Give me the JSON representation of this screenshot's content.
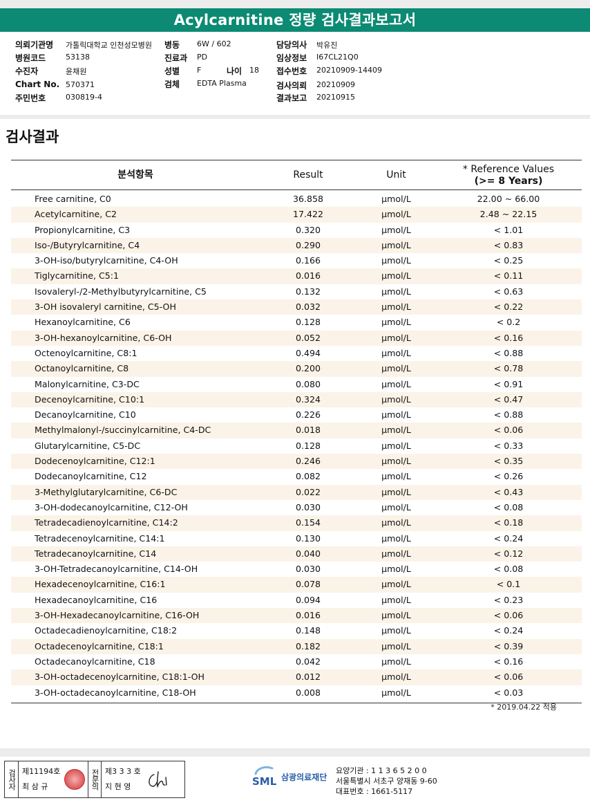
{
  "title": "Acylcarnitine 정량 검사결과보고서",
  "info": {
    "col1": [
      {
        "label": "의뢰기관명",
        "value": "가톨릭대학교 인천성모병원"
      },
      {
        "label": "병원코드",
        "value": "53138"
      },
      {
        "label": "수진자",
        "value": "윤채원"
      },
      {
        "label": "Chart No.",
        "value": "570371"
      },
      {
        "label": "주민번호",
        "value": "030819-4"
      }
    ],
    "col2": [
      {
        "label": "병동",
        "value": "6W / 602"
      },
      {
        "label": "진료과",
        "value": "PD"
      },
      {
        "label": "성별",
        "value": "F"
      },
      {
        "label": "검체",
        "value": "EDTA Plasma"
      }
    ],
    "age": {
      "label": "나이",
      "value": "18"
    },
    "col3": [
      {
        "label": "담당의사",
        "value": "박유진"
      },
      {
        "label": "임상정보",
        "value": "I67CL21Q0"
      },
      {
        "label": "접수번호",
        "value": "20210909-14409"
      },
      {
        "label": "검사의뢰",
        "value": "20210909"
      },
      {
        "label": "결과보고",
        "value": "20210915"
      }
    ]
  },
  "section_title": "검사결과",
  "table": {
    "headers": {
      "item": "분석항목",
      "result": "Result",
      "unit": "Unit",
      "ref_line1": "* Reference Values",
      "ref_line2": "(>= 8 Years)"
    },
    "rows": [
      {
        "name": "Free carnitine, C0",
        "result": "36.858",
        "unit": "µmol/L",
        "ref": "22.00 ~ 66.00"
      },
      {
        "name": "Acetylcarnitine, C2",
        "result": "17.422",
        "unit": "µmol/L",
        "ref": "2.48 ~ 22.15"
      },
      {
        "name": "Propionylcarnitine, C3",
        "result": "0.320",
        "unit": "µmol/L",
        "ref": "< 1.01"
      },
      {
        "name": "Iso-/Butyrylcarnitine, C4",
        "result": "0.290",
        "unit": "µmol/L",
        "ref": "< 0.83"
      },
      {
        "name": "3-OH-iso/butyrylcarnitine, C4-OH",
        "result": "0.166",
        "unit": "µmol/L",
        "ref": "< 0.25"
      },
      {
        "name": "Tiglycarnitine, C5:1",
        "result": "0.016",
        "unit": "µmol/L",
        "ref": "< 0.11"
      },
      {
        "name": "Isovaleryl-/2-Methylbutyrylcarnitine, C5",
        "result": "0.132",
        "unit": "µmol/L",
        "ref": "< 0.63"
      },
      {
        "name": "3-OH isovaleryl carnitine, C5-OH",
        "result": "0.032",
        "unit": "µmol/L",
        "ref": "< 0.22"
      },
      {
        "name": "Hexanoylcarnitine, C6",
        "result": "0.128",
        "unit": "µmol/L",
        "ref": "< 0.2"
      },
      {
        "name": "3-OH-hexanoylcarnitine, C6-OH",
        "result": "0.052",
        "unit": "µmol/L",
        "ref": "< 0.16"
      },
      {
        "name": "Octenoylcarnitine, C8:1",
        "result": "0.494",
        "unit": "µmol/L",
        "ref": "< 0.88"
      },
      {
        "name": "Octanoylcarnitine, C8",
        "result": "0.200",
        "unit": "µmol/L",
        "ref": "< 0.78"
      },
      {
        "name": "Malonylcarnitine, C3-DC",
        "result": "0.080",
        "unit": "µmol/L",
        "ref": "< 0.91"
      },
      {
        "name": "Decenoylcarnitine, C10:1",
        "result": "0.324",
        "unit": "µmol/L",
        "ref": "< 0.47"
      },
      {
        "name": "Decanoylcarnitine, C10",
        "result": "0.226",
        "unit": "µmol/L",
        "ref": "< 0.88"
      },
      {
        "name": "Methylmalonyl-/succinylcarnitine, C4-DC",
        "result": "0.018",
        "unit": "µmol/L",
        "ref": "< 0.06"
      },
      {
        "name": "Glutarylcarnitine, C5-DC",
        "result": "0.128",
        "unit": "µmol/L",
        "ref": "< 0.33"
      },
      {
        "name": "Dodecenoylcarnitine, C12:1",
        "result": "0.246",
        "unit": "µmol/L",
        "ref": "< 0.35"
      },
      {
        "name": "Dodecanoylcarnitine, C12",
        "result": "0.082",
        "unit": "µmol/L",
        "ref": "< 0.26"
      },
      {
        "name": "3-Methylglutarylcarnitine, C6-DC",
        "result": "0.022",
        "unit": "µmol/L",
        "ref": "< 0.43"
      },
      {
        "name": "3-OH-dodecanoylcarnitine, C12-OH",
        "result": "0.030",
        "unit": "µmol/L",
        "ref": "< 0.08"
      },
      {
        "name": "Tetradecadienoylcarnitine, C14:2",
        "result": "0.154",
        "unit": "µmol/L",
        "ref": "< 0.18"
      },
      {
        "name": "Tetradecenoylcarnitine, C14:1",
        "result": "0.130",
        "unit": "µmol/L",
        "ref": "< 0.24"
      },
      {
        "name": "Tetradecanoylcarnitine, C14",
        "result": "0.040",
        "unit": "µmol/L",
        "ref": "< 0.12"
      },
      {
        "name": "3-OH-Tetradecanoylcarnitine, C14-OH",
        "result": "0.030",
        "unit": "µmol/L",
        "ref": "< 0.08"
      },
      {
        "name": "Hexadecenoylcarnitine, C16:1",
        "result": "0.078",
        "unit": "µmol/L",
        "ref": "< 0.1"
      },
      {
        "name": "Hexadecanoylcarnitine, C16",
        "result": "0.094",
        "unit": "µmol/L",
        "ref": "< 0.23"
      },
      {
        "name": "3-OH-Hexadecanoylcarnitine, C16-OH",
        "result": "0.016",
        "unit": "µmol/L",
        "ref": "< 0.06"
      },
      {
        "name": "Octadecadienoylcarnitine, C18:2",
        "result": "0.148",
        "unit": "µmol/L",
        "ref": "< 0.24"
      },
      {
        "name": "Octadecenoylcarnitine, C18:1",
        "result": "0.182",
        "unit": "µmol/L",
        "ref": "< 0.39"
      },
      {
        "name": "Octadecanoylcarnitine, C18",
        "result": "0.042",
        "unit": "µmol/L",
        "ref": "< 0.16"
      },
      {
        "name": "3-OH-octadecenoylcarnitine, C18:1-OH",
        "result": "0.012",
        "unit": "µmol/L",
        "ref": "< 0.06"
      },
      {
        "name": "3-OH-octadecanoylcarnitine, C18-OH",
        "result": "0.008",
        "unit": "µmol/L",
        "ref": "< 0.03"
      }
    ]
  },
  "footnote": "* 2019.04.22 적용",
  "signatures": {
    "label1": "검사자",
    "license1": "제11194호",
    "name1": "최 삼 규",
    "label2": "전문의",
    "license2": "제3 3 3 호",
    "name2": "지 현 영"
  },
  "org": {
    "logo_text": "SML",
    "name": "삼광의료재단",
    "code": "요양기관 : 1 1 3 6 5 2 0 0",
    "address": "서울특별시 서초구 양재동 9-60",
    "phone": "대표번호 : 1661-5117"
  },
  "colors": {
    "title_bar": "#0c8a73",
    "row_shade": "#fbf3e8",
    "logo_blue": "#2a5da8",
    "seal_red": "#d84a4a"
  }
}
